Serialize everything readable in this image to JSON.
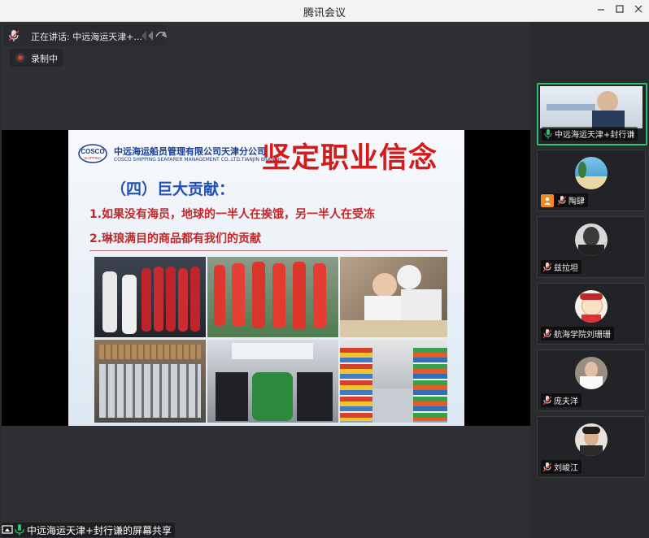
{
  "window": {
    "title": "腾讯会议"
  },
  "status": {
    "speaking": "正在讲话: 中远海运天津+...",
    "recording": "录制中"
  },
  "slide": {
    "company_cn": "中远海运船员管理有限公司天津分公司",
    "company_en": "COSCO SHIPPING SEAFARER MANAGEMENT CO.,LTD.TIANJIN BRANCH",
    "logo_text_top": "COSCO",
    "logo_text_bottom": "SHIPPING",
    "title": "坚定职业信念",
    "subheading": "（四）巨大贡献：",
    "point1": "1.如果没有海员，地球的一半人在挨饿，另一半人在受冻",
    "point2": "2.琳琅满目的商品都有我们的贡献",
    "photos": [
      "ship-engine-room-photo",
      "survival-suits-photo",
      "ship-galley-photo",
      "cargo-goods-photo",
      "meeting-photo",
      "supermarket-photo"
    ]
  },
  "participants": [
    {
      "name": "中远海运天津+封行谦",
      "mic": "on",
      "active": true
    },
    {
      "name": "陶肆",
      "mic": "muted",
      "badge": "user-icon"
    },
    {
      "name": "兹拉坦",
      "mic": "muted"
    },
    {
      "name": "航海学院刘珊珊",
      "mic": "muted"
    },
    {
      "name": "庞夫洋",
      "mic": "muted"
    },
    {
      "name": "刘峻江",
      "mic": "muted"
    }
  ],
  "footer": {
    "share_label": "中远海运天津+封行谦的屏幕共享"
  },
  "colors": {
    "accent_green": "#2fbf71",
    "record_red": "#e53935",
    "title_red": "#d31b1b",
    "subhead_blue": "#2252b8"
  }
}
